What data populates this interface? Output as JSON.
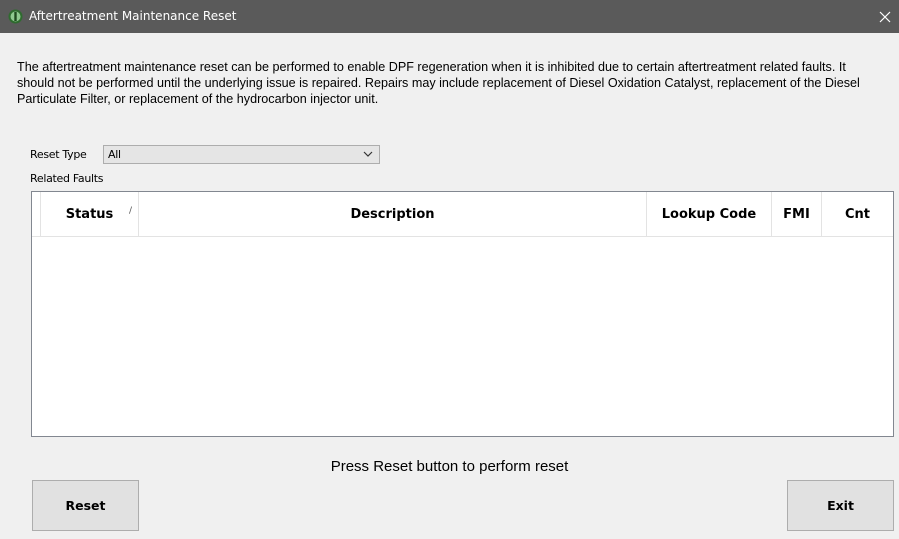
{
  "window": {
    "title": "Aftertreatment Maintenance Reset",
    "icon": "app-logo-icon",
    "close_icon": "close-icon",
    "title_bar_color": "#5a5a5a"
  },
  "intro": {
    "text": "The aftertreatment maintenance reset can be performed to enable DPF regeneration when it is inhibited due to certain aftertreatment related faults. It should not be performed until the underlying issue is repaired. Repairs may include replacement of Diesel Oxidation Catalyst, replacement of the Diesel Particulate Filter, or replacement of the hydrocarbon injector unit."
  },
  "reset_type": {
    "label": "Reset Type",
    "selected": "All"
  },
  "related_faults": {
    "label": "Related Faults",
    "columns": [
      {
        "key": "status",
        "label": "Status",
        "sorted": true
      },
      {
        "key": "description",
        "label": "Description"
      },
      {
        "key": "lookup_code",
        "label": "Lookup Code"
      },
      {
        "key": "fmi",
        "label": "FMI"
      },
      {
        "key": "cnt",
        "label": "Cnt"
      }
    ],
    "rows": []
  },
  "status_message": "Press Reset button to perform reset",
  "buttons": {
    "reset_label": "Reset",
    "exit_label": "Exit"
  }
}
